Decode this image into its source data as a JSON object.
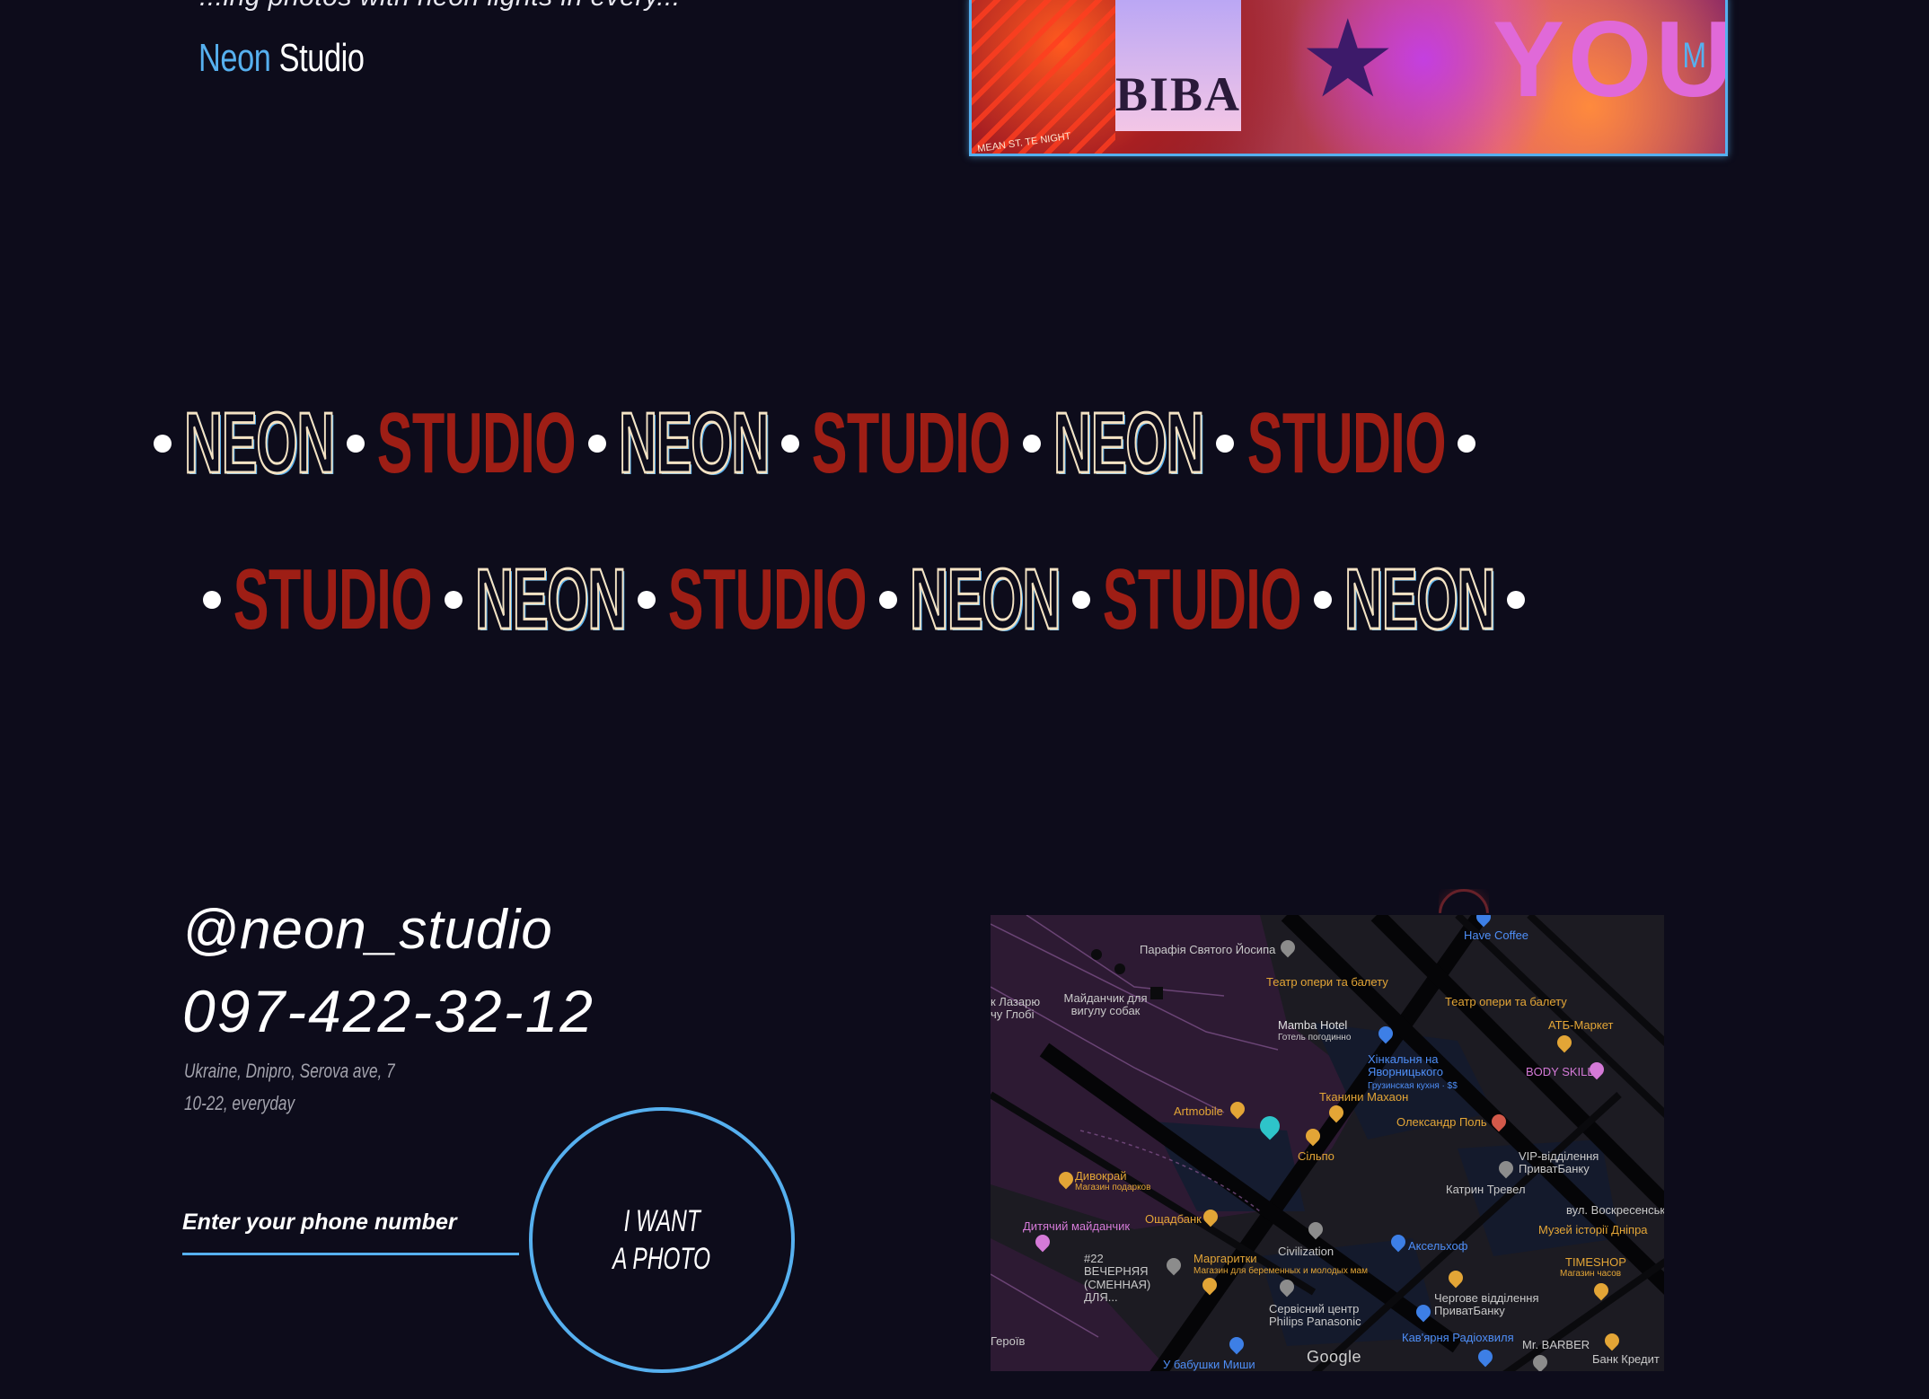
{
  "brand": {
    "logo_word_1": "Neon",
    "logo_word_2": "Studio",
    "cut_text": "...ing photos with neon lights in every..."
  },
  "hero_photo": {
    "sign_text": "BIBA",
    "word": "YOU",
    "side_letter": "M",
    "tiny_caption": "MEAN ST. TE NIGHT"
  },
  "ticker": {
    "row1": [
      "NEON",
      "STUDIO",
      "NEON",
      "STUDIO",
      "NEON",
      "STUDIO"
    ],
    "row2": [
      "STUDIO",
      "NEON",
      "STUDIO",
      "NEON",
      "STUDIO",
      "NEON"
    ]
  },
  "contact": {
    "handle": "@neon_studio",
    "phone": "097-422-32-12",
    "address": "Ukraine, Dnipro, Serova ave, 7",
    "hours": "10-22, everyday"
  },
  "form": {
    "phone_placeholder": "Enter your phone number",
    "button_line_1": "I WANT",
    "button_line_2": "A PHOTO"
  },
  "map": {
    "labels": [
      {
        "text": "Парафія Святого Йосипа",
        "color": "gray"
      },
      {
        "text": "Театр опери та балету",
        "color": "orange"
      },
      {
        "text": "Театр опери та балету",
        "color": "orange"
      },
      {
        "text": "Have Coffee",
        "color": "blue"
      },
      {
        "text": "АТБ-Маркет",
        "color": "orange"
      },
      {
        "text": "Майданчик для вигулу собак",
        "color": "gray"
      },
      {
        "text": "к Лазарю чу Глобі",
        "color": "gray"
      },
      {
        "text": "Mamba Hotel",
        "color": "gray"
      },
      {
        "text": "Готель погодинно",
        "color": "gray"
      },
      {
        "text": "Хінкальня на Яворницького",
        "color": "blue"
      },
      {
        "text": "Грузинская кухня · $$",
        "color": "blue"
      },
      {
        "text": "BODY SKILL",
        "color": "pink"
      },
      {
        "text": "Тканини Махаон",
        "color": "orange"
      },
      {
        "text": "Artmobile",
        "color": "orange"
      },
      {
        "text": "Олександр Поль",
        "color": "orange"
      },
      {
        "text": "Сільпо",
        "color": "orange"
      },
      {
        "text": "VIP-відділення ПриватБанку",
        "color": "gray"
      },
      {
        "text": "Катрин Тревел",
        "color": "gray"
      },
      {
        "text": "Дивокрай",
        "color": "orange"
      },
      {
        "text": "Магазин подарков",
        "color": "orange"
      },
      {
        "text": "вул. Воскресенська",
        "color": "gray"
      },
      {
        "text": "Дитячий майданчик",
        "color": "pink"
      },
      {
        "text": "Ощадбанк",
        "color": "orange"
      },
      {
        "text": "Музей історії Дніпра",
        "color": "orange"
      },
      {
        "text": "Civilization",
        "color": "gray"
      },
      {
        "text": "Аксельхоф",
        "color": "blue"
      },
      {
        "text": "TIMESHOP",
        "color": "orange"
      },
      {
        "text": "Магазин часов",
        "color": "orange"
      },
      {
        "text": "#22 ВЕЧЕРНЯЯ (СМЕННАЯ) ДЛЯ...",
        "color": "gray"
      },
      {
        "text": "Маргаритки",
        "color": "orange"
      },
      {
        "text": "Магазин для беременных и молодых мам",
        "color": "orange"
      },
      {
        "text": "Чергове відділення ПриватБанку",
        "color": "gray"
      },
      {
        "text": "Сервісний центр Philips Panasonic",
        "color": "gray"
      },
      {
        "text": "Кав'ярня Радіохвиля",
        "color": "blue"
      },
      {
        "text": "Mr. BARBER",
        "color": "gray"
      },
      {
        "text": "Героїв",
        "color": "gray"
      },
      {
        "text": "У бабушки Миши",
        "color": "blue"
      },
      {
        "text": "Банк Кредит",
        "color": "gray"
      }
    ],
    "google_text": "Google"
  },
  "colors": {
    "background": "#0d0c1b",
    "accent_blue": "#56b0ef",
    "studio_red": "#9e1e15",
    "neon_outline": "#f4e3c4"
  }
}
